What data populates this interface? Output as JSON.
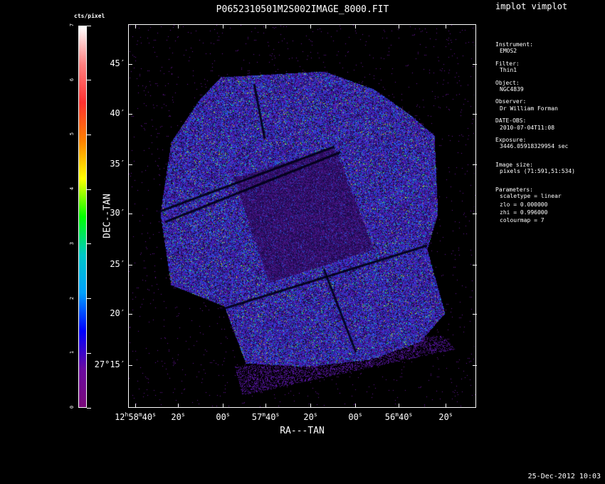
{
  "title": "P0652310501M2S002IMAGE_8000.FIT",
  "app_label": "implot vimplot",
  "colorbar": {
    "label": "cts/pixel",
    "ticks": [
      "0",
      "1",
      "2",
      "3",
      "4",
      "5",
      "6",
      "7"
    ],
    "colors": [
      "#7a0a7a",
      "#6a0aa0",
      "#0000ff",
      "#00a0ff",
      "#00c8c8",
      "#00ff00",
      "#ffff00",
      "#ff8000",
      "#ff3030",
      "#ff8080",
      "#ffffff"
    ]
  },
  "axes": {
    "ylabel": "DEC--TAN",
    "xlabel": "RA---TAN",
    "y_ticks": [
      {
        "deg": "",
        "min": "45",
        "sec": ""
      },
      {
        "deg": "",
        "min": "40",
        "sec": ""
      },
      {
        "deg": "",
        "min": "35",
        "sec": ""
      },
      {
        "deg": "",
        "min": "30",
        "sec": ""
      },
      {
        "deg": "",
        "min": "25",
        "sec": ""
      },
      {
        "deg": "",
        "min": "20",
        "sec": ""
      },
      {
        "deg": "27",
        "min": "15",
        "sec": ""
      }
    ],
    "x_ticks": [
      {
        "h": "12",
        "m": "58",
        "s": "40"
      },
      {
        "h": "",
        "m": "",
        "s": "20"
      },
      {
        "h": "",
        "m": "",
        "s": "00"
      },
      {
        "h": "",
        "m": "57",
        "s": "40"
      },
      {
        "h": "",
        "m": "",
        "s": "20"
      },
      {
        "h": "",
        "m": "",
        "s": "00"
      },
      {
        "h": "",
        "m": "56",
        "s": "40"
      },
      {
        "h": "",
        "m": "",
        "s": "20"
      }
    ]
  },
  "info": {
    "instrument_key": "Instrument:",
    "instrument": "EMOS2",
    "filter_key": "Filter:",
    "filter": "Thin1",
    "object_key": "Object:",
    "object": "NGC4839",
    "observer_key": "Observer:",
    "observer": "Dr William Forman",
    "date_key": "DATE-OBS:",
    "date": "2010-07-04T11:08",
    "exposure_key": "Exposure:",
    "exposure": "3446.05918329954 sec",
    "imgsize_key": "Image size:",
    "imgsize": "pixels (71:591,51:534)",
    "params_key": "Parameters:",
    "scaletype": "scaletype = linear",
    "zlo": "zlo = 0.000000",
    "zhi": "zhi = 0.996000",
    "colourmap": "colourmap =   7"
  },
  "timestamp": "25-Dec-2012 10:03"
}
